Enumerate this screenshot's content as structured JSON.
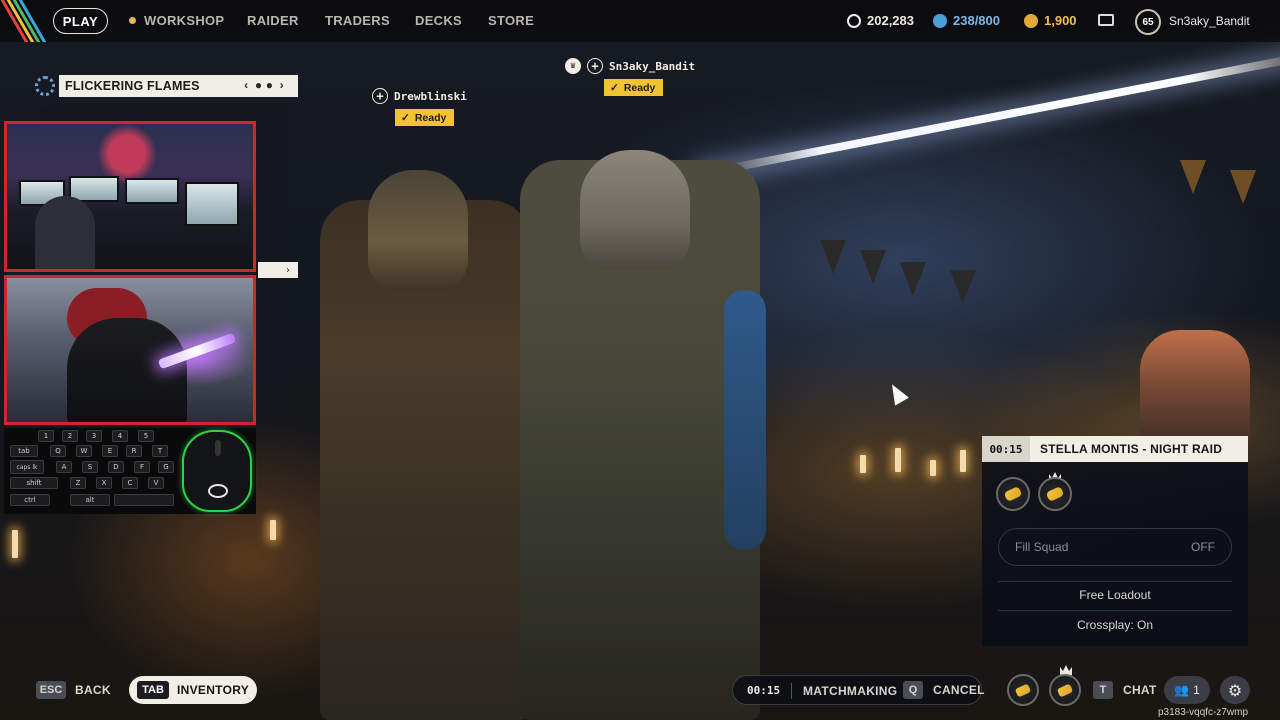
{
  "topbar": {
    "play": "PLAY",
    "nav": [
      "WORKSHOP",
      "RAIDER",
      "TRADERS",
      "DECKS",
      "STORE"
    ],
    "currency_coins": "202,283",
    "currency_storage": "238/800",
    "currency_credits": "1,900",
    "player_level": "65",
    "username": "Sn3aky_Bandit"
  },
  "left_panel": {
    "title": "FLICKERING FLAMES",
    "pager_prev": "‹",
    "pager_next": "›",
    "pager_next2": "›"
  },
  "keyboard": {
    "row1": [
      "1",
      "2",
      "3",
      "4",
      "5"
    ],
    "row2": [
      "tab",
      "Q",
      "W",
      "E",
      "R",
      "T"
    ],
    "row3": [
      "caps lk",
      "A",
      "S",
      "D",
      "F",
      "G"
    ],
    "row4": [
      "shift",
      "Z",
      "X",
      "C",
      "V"
    ],
    "row5": [
      "ctrl",
      "alt"
    ]
  },
  "squad": {
    "players": [
      {
        "name": "Drewblinski",
        "status": "Ready"
      },
      {
        "name": "Sn3aky_Bandit",
        "status": "Ready"
      }
    ]
  },
  "match": {
    "timer": "00:15",
    "title": "STELLA MONTIS - NIGHT RAID",
    "fill_squad_label": "Fill Squad",
    "fill_squad_value": "OFF",
    "loadout": "Free Loadout",
    "crossplay": "Crossplay: On"
  },
  "bottom": {
    "back_key": "ESC",
    "back_label": "BACK",
    "inventory_key": "TAB",
    "inventory_label": "INVENTORY",
    "mm_timer": "00:15",
    "mm_label": "MATCHMAKING",
    "cancel_key": "Q",
    "cancel_label": "CANCEL",
    "chat_key": "T",
    "chat_label": "CHAT",
    "party_count": "1",
    "session_code": "p3183-vqqfc-z7wmp"
  },
  "colors": {
    "ready": "#f2c230",
    "webcam_border": "#d2252a",
    "mouse_glow": "#2fd14c",
    "panel_header": "#f1eee6"
  }
}
